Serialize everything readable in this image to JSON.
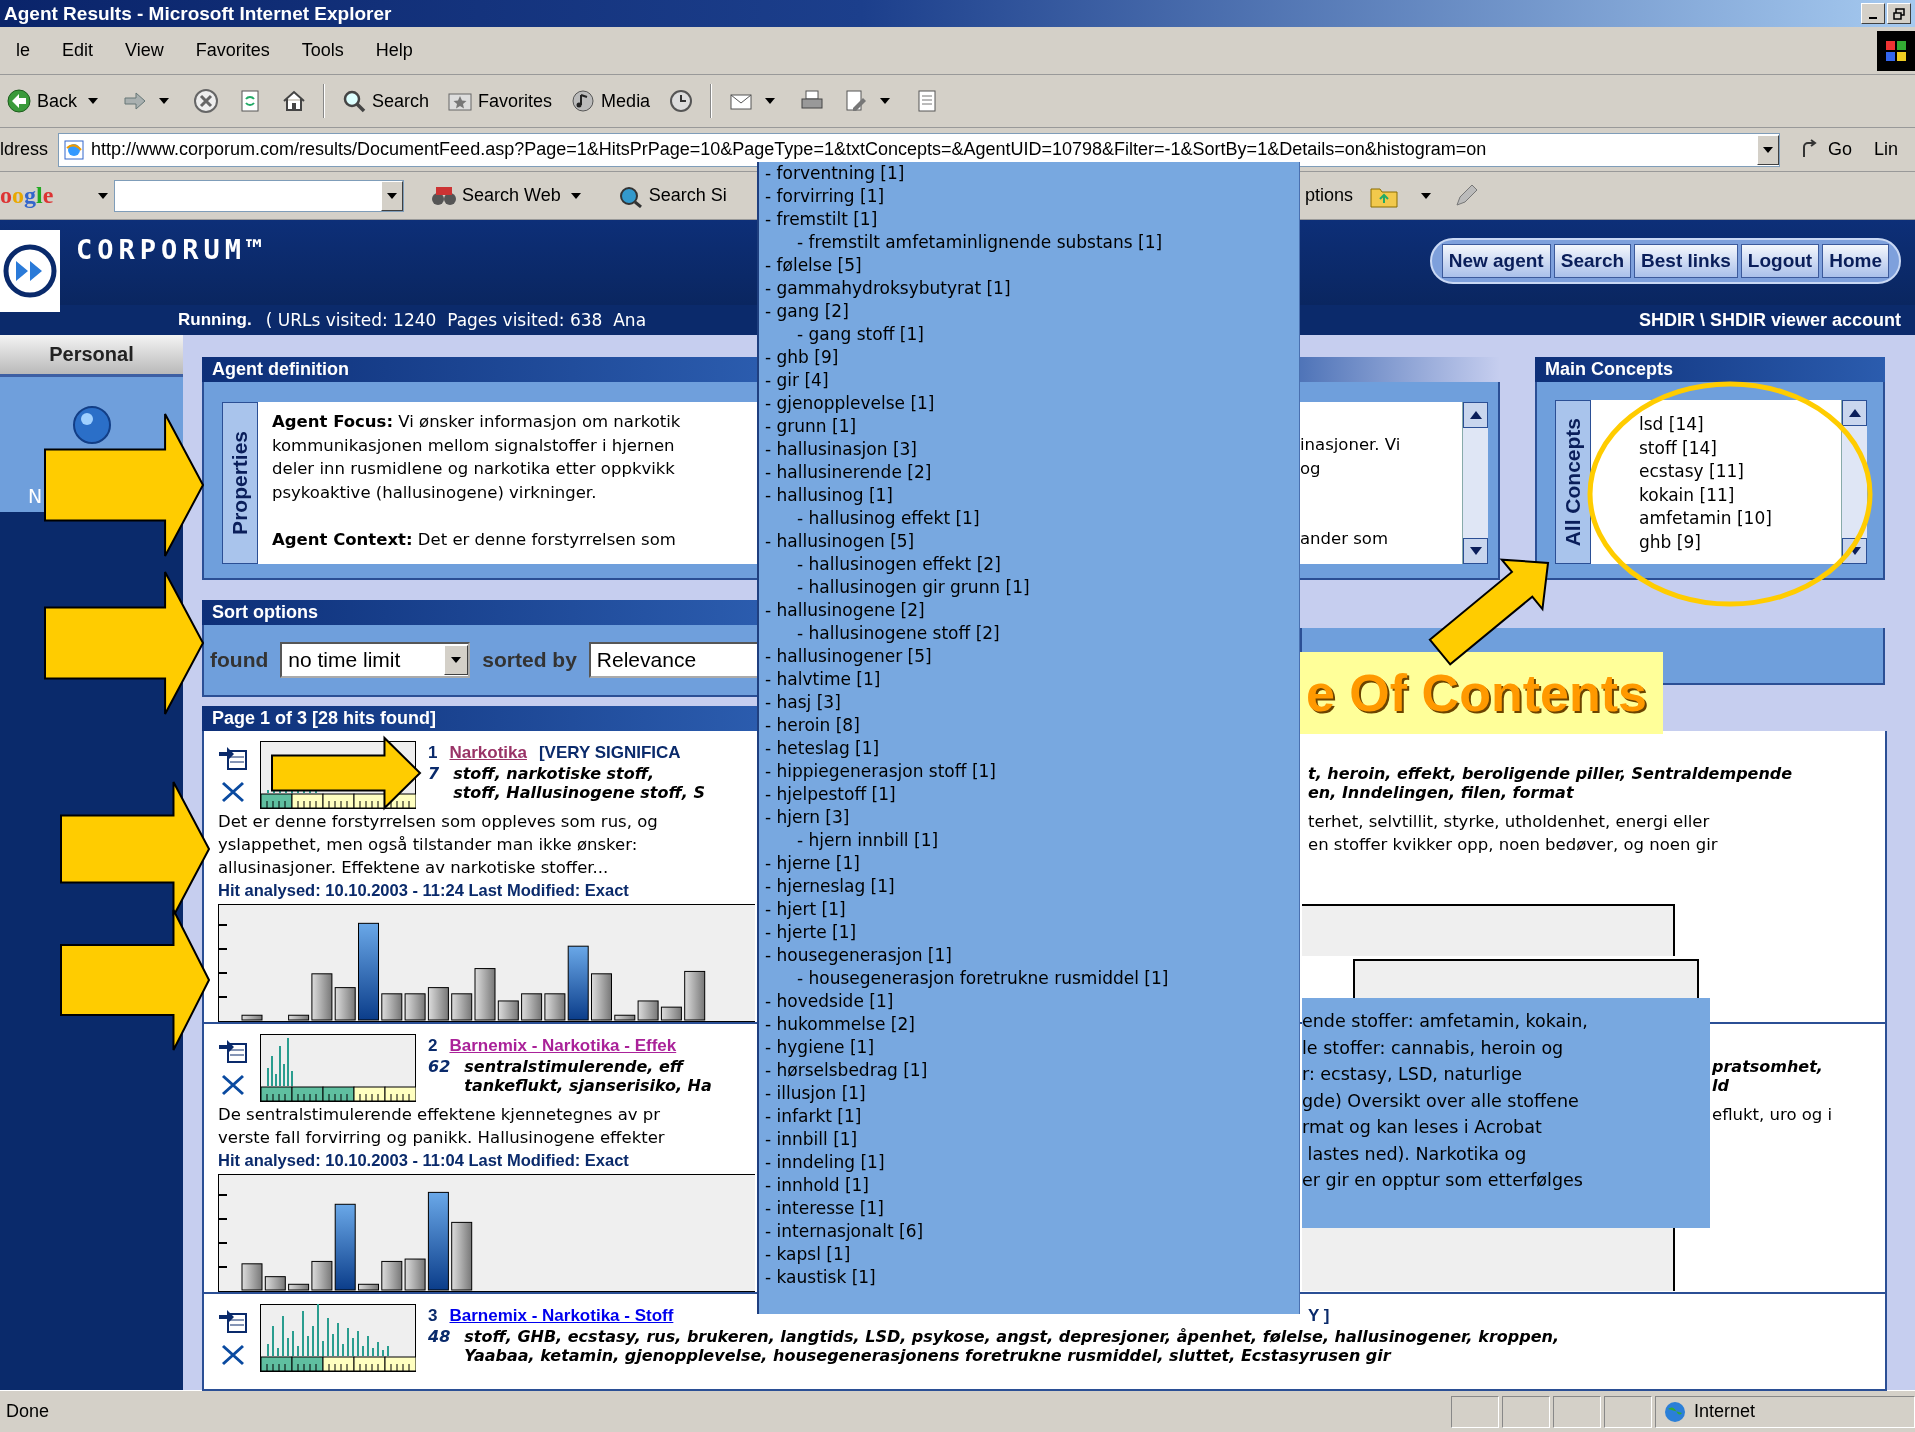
{
  "window": {
    "title": "Agent Results - Microsoft Internet Explorer"
  },
  "menu": [
    "le",
    "Edit",
    "View",
    "Favorites",
    "Tools",
    "Help"
  ],
  "toolbar": [
    {
      "kind": "back",
      "label": "Back"
    },
    {
      "kind": "forward"
    },
    {
      "kind": "stop"
    },
    {
      "kind": "refresh"
    },
    {
      "kind": "home"
    },
    {
      "kind": "search",
      "label": "Search"
    },
    {
      "kind": "favorites",
      "label": "Favorites"
    },
    {
      "kind": "media",
      "label": "Media"
    },
    {
      "kind": "history"
    },
    {
      "kind": "mail"
    },
    {
      "kind": "print"
    },
    {
      "kind": "edit"
    },
    {
      "kind": "discuss"
    }
  ],
  "address_bar": {
    "label": "ldress",
    "url": "http://www.corporum.com/results/DocumentFeed.asp?Page=1&HitsPrPage=10&PageType=1&txtConcepts=&AgentUID=10798&Filter=-1&SortBy=1&Details=on&histogram=on",
    "go": "Go",
    "links": "Lin"
  },
  "google_toolbar": {
    "logo": "oogle",
    "buttons": [
      "Search Web",
      "Search Si"
    ],
    "options": "ptions"
  },
  "site_header": {
    "logo": "CORPORUM™",
    "nav": [
      "New agent",
      "Search",
      "Best links",
      "Logout",
      "Home"
    ],
    "state": "Running.",
    "progress": "( URLs visited: 1240  Pages visited: 638  Ana",
    "account": "SHDIR \\ SHDIR viewer account"
  },
  "sidebar": {
    "tab": "Personal",
    "label": "N"
  },
  "agent_definition": {
    "title": "Agent definition",
    "tab": "Properties",
    "text": "**Agent Focus:** Vi ønsker informasjon om narkotik\nkommunikasjonen mellom signalstoffer i hjernen\ndeler inn rusmidlene og narkotika etter oppkvikk\npsykoaktive (hallusinogene) virkninger.\n\n**Agent Context:** Det er denne forstyrrelsen som",
    "text_right": "inasjoner. Vi\nog\n\n\nander som"
  },
  "main_concepts": {
    "title": "Main Concepts",
    "tab": "All Concepts",
    "items": [
      "lsd [14]",
      "stoff [14]",
      "ecstasy [11]",
      "kokain [11]",
      "amfetamin [10]",
      "ghb [9]"
    ]
  },
  "sort_options": {
    "title": "Sort options",
    "found_label": "found",
    "period": "no time limit",
    "sorted_label": "sorted by",
    "order": "Relevance"
  },
  "results": {
    "title": "Page 1 of 3 [28 hits found]",
    "items": [
      {
        "number": "1",
        "title": "Narkotika",
        "color": "#993366",
        "significance": "[VERY SIGNIFICA",
        "score": "7",
        "keywords": "stoff, narkotiske stoff,\nstoff, Hallusinogene stoff, S",
        "description": "Det er denne forstyrrelsen som oppleves som rus, og\nyslappethet, men også tilstander man ikke ønsker:\nallusinasjoner. Effektene av narkotiske stoffer...",
        "analysed": "Hit analysed: 10.10.2003 - 11:24 Last Modified: Exact",
        "right": {
          "keywords": "t, heroin, effekt, beroligende piller, Sentraldempende\nen, Inndelingen, filen, format",
          "description": "terhet, selvtillit, styrke, utholdenhet, energi eller\nen stoffer kvikker opp, noen bedøver, og noen gir"
        }
      },
      {
        "number": "2",
        "title": "Barnemix - Narkotika - Effek",
        "color": "#aa2299",
        "score": "62",
        "keywords": "sentralstimulerende, eff\ntankeflukt, sjanserisiko, Ha",
        "description": "De sentralstimulerende effektene kjennetegnes av pr\nverste fall forvirring og panikk. Hallusinogene effekter",
        "analysed": "Hit analysed: 10.10.2003 - 11:04 Last Modified: Exact",
        "right": {
          "keywords": "pratsomhet,\nld",
          "description": "eflukt, uro og i"
        }
      },
      {
        "number": "3",
        "title": "Barnemix - Narkotika - Stoff",
        "color": "#0000ee",
        "score": "48",
        "keywords": "stoff, GHB, ecstasy, rus, brukeren, langtids, LSD, psykose, angst, depresjoner, åpenhet, følelse, hallusinogener, kroppen,\nYaabaa, ketamin, gjenopplevelse, housegenerasjonens foretrukne rusmiddel, sluttet, Ecstasyrusen gir",
        "right": {
          "title": "Y ]"
        }
      }
    ]
  },
  "concept_dropdown": {
    "items": [
      {
        "label": "- forventning [1]"
      },
      {
        "label": "- forvirring [1]"
      },
      {
        "label": "- fremstilt [1]",
        "children": [
          {
            "label": "- fremstilt amfetaminlignende substans [1]"
          }
        ]
      },
      {
        "label": "- følelse [5]"
      },
      {
        "label": "- gammahydroksybutyrat [1]"
      },
      {
        "label": "- gang [2]",
        "children": [
          {
            "label": "- gang stoff [1]"
          }
        ]
      },
      {
        "label": "- ghb [9]"
      },
      {
        "label": "- gir [4]"
      },
      {
        "label": "- gjenopplevelse [1]"
      },
      {
        "label": "- grunn [1]"
      },
      {
        "label": "- hallusinasjon [3]"
      },
      {
        "label": "- hallusinerende [2]"
      },
      {
        "label": "- hallusinog [1]",
        "children": [
          {
            "label": "- hallusinog effekt [1]"
          }
        ]
      },
      {
        "label": "- hallusinogen [5]",
        "children": [
          {
            "label": "- hallusinogen effekt [2]"
          },
          {
            "label": "- hallusinogen gir grunn [1]"
          }
        ]
      },
      {
        "label": "- hallusinogene [2]",
        "children": [
          {
            "label": "- hallusinogene stoff [2]"
          }
        ]
      },
      {
        "label": "- hallusinogener [5]"
      },
      {
        "label": "- halvtime [1]"
      },
      {
        "label": "- hasj [3]"
      },
      {
        "label": "- heroin [8]"
      },
      {
        "label": "- heteslag [1]"
      },
      {
        "label": "- hippiegenerasjon stoff [1]"
      },
      {
        "label": "- hjelpestoff [1]"
      },
      {
        "label": "- hjern [3]",
        "children": [
          {
            "label": "- hjern innbill [1]"
          }
        ]
      },
      {
        "label": "- hjerne [1]"
      },
      {
        "label": "- hjerneslag [1]"
      },
      {
        "label": "- hjert [1]"
      },
      {
        "label": "- hjerte [1]"
      },
      {
        "label": "- housegenerasjon [1]",
        "children": [
          {
            "label": "- housegenerasjon foretrukne rusmiddel [1]"
          }
        ]
      },
      {
        "label": "- hovedside [1]"
      },
      {
        "label": "- hukommelse [2]"
      },
      {
        "label": "- hygiene [1]"
      },
      {
        "label": "- hørselsbedrag [1]"
      },
      {
        "label": "- illusjon [1]"
      },
      {
        "label": "- infarkt [1]"
      },
      {
        "label": "- innbill [1]"
      },
      {
        "label": "- inndeling [1]"
      },
      {
        "label": "- innhold [1]"
      },
      {
        "label": "- interesse [1]"
      },
      {
        "label": "- internasjonalt [6]"
      },
      {
        "label": "- kapsl [1]"
      },
      {
        "label": "- kaustisk [1]"
      }
    ]
  },
  "toc_label": "e Of Contents",
  "preview_popup": {
    "lines": [
      "ende stoffer: amfetamin, kokain,",
      "le stoffer: cannabis, heroin og",
      "r: ecstasy, LSD, naturlige",
      "gde) Oversikt over alle stoffene",
      "rmat og kan leses i Acrobat",
      " lastes ned). Narkotika og",
      "er gir en opptur som etterfølges"
    ]
  },
  "status_bar": {
    "text": "Done",
    "zone": "Internet"
  }
}
